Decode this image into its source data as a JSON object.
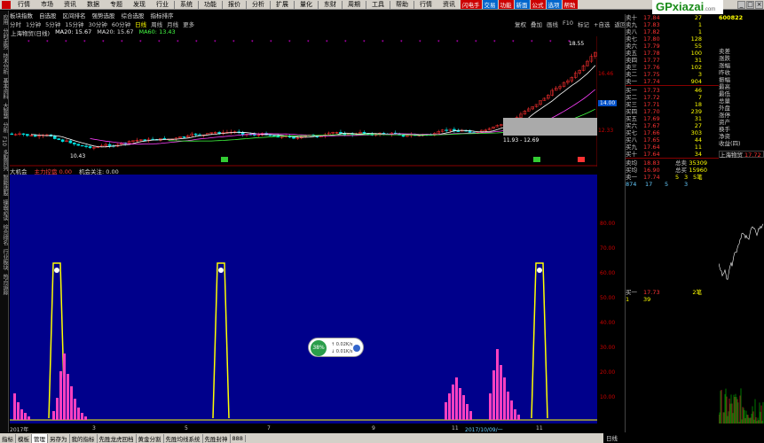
{
  "app": {
    "top_menu": [
      "行情",
      "市场",
      "资讯",
      "数据",
      "专题",
      "发现",
      "行业",
      "|",
      "系统",
      "|",
      "功能",
      "|",
      "报价",
      "|",
      "分析",
      "|",
      "扩展",
      "|",
      "量化",
      "|",
      "东财",
      "|",
      "周期",
      "|",
      "工具",
      "|",
      "帮助",
      "|",
      "行情",
      "资讯"
    ],
    "badges": [
      "闪电手",
      "交易",
      "功能",
      "新面",
      "公式",
      "选项",
      "帮助"
    ],
    "logo_text": "GPxiazai",
    "logo_sub": ".com",
    "logo_caption": "股票下载网",
    "window_buttons": [
      "_",
      "□",
      "×"
    ]
  },
  "menu2": [
    "板块指数",
    "自选股",
    "区间排名",
    "强势选股",
    "综合选股",
    "指标排序"
  ],
  "period_toolbar": {
    "items": [
      "分时",
      "1分钟",
      "5分钟",
      "15分钟",
      "30分钟",
      "60分钟",
      "日线",
      "周线",
      "月线",
      "更多"
    ],
    "selected": "日线"
  },
  "right_toolbar": [
    "复权",
    "叠加",
    "画线",
    "F10",
    "标记",
    "+自选",
    "返回"
  ],
  "left_side_tabs": [
    "应用",
    "分时走势",
    "技术分析",
    "基本资料",
    "大智慧"
  ],
  "left_side_tabs2": [
    "分析",
    "F10",
    "多股同列",
    "智能选股",
    "操盘必读",
    "综合排名",
    "行业板块",
    "热点追踪"
  ],
  "stock_label": "上海物贸(日线)",
  "ma_labels": [
    {
      "text": "MA20: 15.67",
      "color": "#ffffff"
    },
    {
      "text": "MA20: 15.67",
      "color": "#e0e0e0"
    },
    {
      "text": "MA60: 13.43",
      "color": "#40ff40"
    }
  ],
  "kline_annotations": {
    "low_label": "10.43",
    "high_label": "18.55",
    "range_label": "11.93 - 12.69",
    "marker_labels": [
      "涨",
      "涨",
      "跌"
    ]
  },
  "k_axis": [
    "16.46",
    "14.00",
    "12.33"
  ],
  "k_axis_box_value": "14.00",
  "sub_header": {
    "name": "大机会",
    "ind1": "主力控盘 0.00",
    "ind2": "机会关注: 0.00"
  },
  "sub_axis": [
    "80.00",
    "70.00",
    "60.00",
    "50.00",
    "40.00",
    "30.00",
    "20.00",
    "10.00"
  ],
  "sub_axis_right": [
    "80.00",
    "70.00",
    "60.00",
    "50.00",
    "40.00",
    "30.00",
    "20.00",
    "10.00"
  ],
  "date_axis": [
    "2017年",
    "3",
    "5",
    "7",
    "9",
    "11",
    "2017/10/09/一",
    "11"
  ],
  "bottom_tabs": [
    "指标",
    "模板",
    "管理",
    "另存为",
    "我的指标",
    "先胜龙虎回档",
    "黄金分割",
    "先胜均线系统",
    "先胜封神",
    "888"
  ],
  "bottom_selected": "管理",
  "bottom_date": "日线",
  "orderbook": {
    "title_left": "卖十",
    "code": "600822",
    "name": "上海物贸",
    "sell": [
      {
        "l": "卖十",
        "p": "17.84",
        "v": "27"
      },
      {
        "l": "卖九",
        "p": "17.83",
        "v": "1"
      },
      {
        "l": "卖八",
        "p": "17.82",
        "v": "1"
      },
      {
        "l": "卖七",
        "p": "17.80",
        "v": "128"
      },
      {
        "l": "卖六",
        "p": "17.79",
        "v": "55"
      },
      {
        "l": "卖五",
        "p": "17.78",
        "v": "100"
      },
      {
        "l": "卖四",
        "p": "17.77",
        "v": "31"
      },
      {
        "l": "卖三",
        "p": "17.76",
        "v": "102"
      },
      {
        "l": "卖二",
        "p": "17.75",
        "v": "3"
      },
      {
        "l": "卖一",
        "p": "17.74",
        "v": "904"
      }
    ],
    "buy": [
      {
        "l": "买一",
        "p": "17.73",
        "v": "46"
      },
      {
        "l": "买二",
        "p": "17.72",
        "v": "7"
      },
      {
        "l": "买三",
        "p": "17.71",
        "v": "18"
      },
      {
        "l": "买四",
        "p": "17.70",
        "v": "239"
      },
      {
        "l": "买五",
        "p": "17.69",
        "v": "31"
      },
      {
        "l": "买六",
        "p": "17.67",
        "v": "27"
      },
      {
        "l": "买七",
        "p": "17.66",
        "v": "303"
      },
      {
        "l": "买八",
        "p": "17.65",
        "v": "44"
      },
      {
        "l": "买九",
        "p": "17.64",
        "v": "11"
      },
      {
        "l": "买十",
        "p": "17.64",
        "v": "34"
      }
    ],
    "avg_sell": {
      "l": "卖均",
      "p": "18.83",
      "k": "总卖",
      "v": "35309"
    },
    "avg_buy": {
      "l": "买均",
      "p": "16.90",
      "k": "总买",
      "v": "15960"
    },
    "last_row": {
      "l": "卖一",
      "p": "17.74",
      "n1": "5",
      "n2": "3",
      "n3": "5笔"
    },
    "last_row2": {
      "a": "874",
      "b": "17",
      "c": "5",
      "d": "3"
    },
    "buy1_line": {
      "l": "买一",
      "p": "17.73",
      "v": "2笔"
    },
    "buy1_line2": {
      "a": "1",
      "b": "39"
    }
  },
  "fields": [
    "卖差",
    "涨跌",
    "涨幅",
    "昨收",
    "振幅",
    "最高",
    "最低",
    "总量",
    "外盘",
    "涨停",
    "资产",
    "换手",
    "净资",
    "收益(四)"
  ],
  "fields_title_price": "17.72",
  "float_widget": {
    "pct": "38%",
    "up": "0.02K/s",
    "down": "0.01K/s"
  }
}
